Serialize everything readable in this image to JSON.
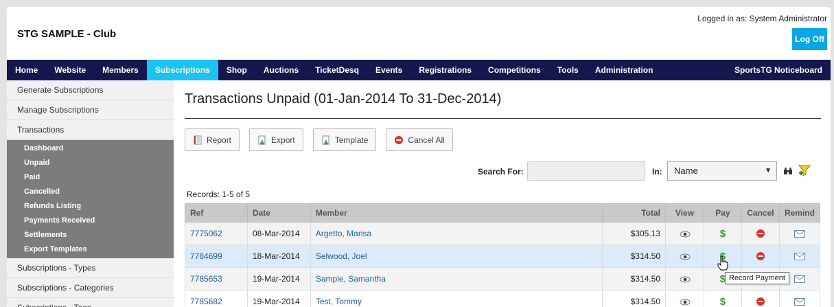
{
  "header": {
    "club_title": "STG SAMPLE - Club",
    "logged_in": "Logged in as: System Administrator",
    "log_off": "Log Off"
  },
  "nav": {
    "items": [
      "Home",
      "Website",
      "Members",
      "Subscriptions",
      "Shop",
      "Auctions",
      "TicketDesq",
      "Events",
      "Registrations",
      "Competitions",
      "Tools",
      "Administration"
    ],
    "active": "Subscriptions",
    "right": "SportsTG Noticeboard"
  },
  "sidebar": {
    "top": [
      "Generate Subscriptions",
      "Manage Subscriptions",
      "Transactions"
    ],
    "sub": [
      "Dashboard",
      "Unpaid",
      "Paid",
      "Cancelled",
      "Refunds Listing",
      "Payments Received",
      "Settlements",
      "Export Templates"
    ],
    "bottom": [
      "Subscriptions - Types",
      "Subscriptions - Categories",
      "Subscriptions - Tags"
    ]
  },
  "main": {
    "title": "Transactions Unpaid (01-Jan-2014 To 31-Dec-2014)",
    "buttons": {
      "report": "Report",
      "export": "Export",
      "template": "Template",
      "cancel_all": "Cancel All"
    },
    "search": {
      "label": "Search For:",
      "value": "",
      "in_label": "In:",
      "in_value": "Name"
    },
    "records": "Records: 1-5 of 5"
  },
  "table": {
    "headers": {
      "ref": "Ref",
      "date": "Date",
      "member": "Member",
      "total": "Total",
      "view": "View",
      "pay": "Pay",
      "cancel": "Cancel",
      "remind": "Remind"
    },
    "rows": [
      {
        "ref": "7775062",
        "date": "08-Mar-2014",
        "member": "Argetto, Marisa",
        "total": "$305.13"
      },
      {
        "ref": "7784699",
        "date": "18-Mar-2014",
        "member": "Selwood, Joel",
        "total": "$314.50"
      },
      {
        "ref": "7785653",
        "date": "19-Mar-2014",
        "member": "Sample, Samantha",
        "total": "$314.50"
      },
      {
        "ref": "7785682",
        "date": "19-Mar-2014",
        "member": "Test, Tommy",
        "total": "$314.50"
      }
    ]
  },
  "tooltip": "Record Payment",
  "colors": {
    "nav_bg": "#15184e",
    "nav_active": "#19c4f0",
    "logoff": "#0aa7e6",
    "link": "#1d5fa8",
    "pay_green": "#3a9a2e",
    "cancel_red": "#d9342b"
  }
}
